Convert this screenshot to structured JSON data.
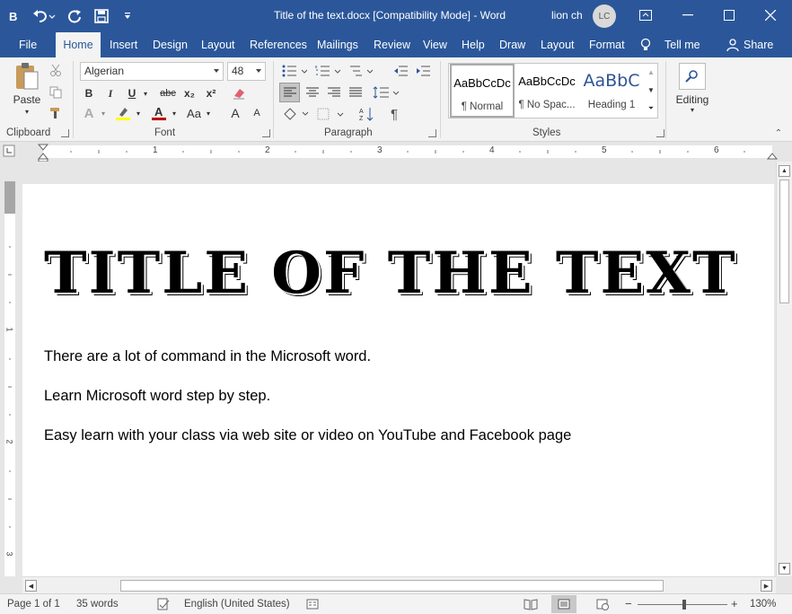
{
  "window": {
    "title": "Title of the text.docx  [Compatibility Mode]  -  Word",
    "user_name": "lion ch",
    "user_initials": "LC"
  },
  "tabs": [
    {
      "label": "File"
    },
    {
      "label": "Home"
    },
    {
      "label": "Insert"
    },
    {
      "label": "Design"
    },
    {
      "label": "Layout"
    },
    {
      "label": "References"
    },
    {
      "label": "Mailings"
    },
    {
      "label": "Review"
    },
    {
      "label": "View"
    },
    {
      "label": "Help"
    },
    {
      "label": "Draw"
    },
    {
      "label": "Layout"
    },
    {
      "label": "Format"
    },
    {
      "label": "Tell me"
    },
    {
      "label": "Share"
    }
  ],
  "active_tab": "Home",
  "ribbon": {
    "clipboard": {
      "paste_label": "Paste",
      "group_label": "Clipboard"
    },
    "font": {
      "group_label": "Font",
      "font_name": "Algerian",
      "font_size": "48",
      "bold": "B",
      "italic": "I",
      "underline": "U",
      "strike": "abc",
      "subscript": "x₂",
      "superscript": "x²",
      "change_case": "Aa",
      "grow": "A",
      "shrink": "A"
    },
    "paragraph": {
      "group_label": "Paragraph"
    },
    "styles": {
      "group_label": "Styles",
      "items": [
        {
          "sample": "AaBbCcDc",
          "name": "¶ Normal"
        },
        {
          "sample": "AaBbCcDc",
          "name": "¶ No Spac..."
        },
        {
          "sample": "AaBbC",
          "name": "Heading 1"
        }
      ]
    },
    "editing": {
      "label": "Editing"
    }
  },
  "document": {
    "title": "TITLE OF THE TEXT",
    "paragraphs": [
      "There are a lot of command in the Microsoft word.",
      "Learn Microsoft word step by step.",
      "Easy learn with your class via web site or video on YouTube and Facebook page"
    ]
  },
  "ruler": {
    "h_numbers": [
      "1",
      "2",
      "3",
      "4",
      "5",
      "6"
    ],
    "v_numbers": [
      "1",
      "2",
      "3"
    ]
  },
  "status": {
    "page": "Page 1 of 1",
    "words": "35 words",
    "language": "English (United States)",
    "zoom": "130%"
  },
  "colors": {
    "accent": "#2b579a",
    "ribbon_bg": "#f3f3f3",
    "highlight": "#ffff00",
    "font_color": "#c00000",
    "heading_blue": "#2f5496"
  }
}
